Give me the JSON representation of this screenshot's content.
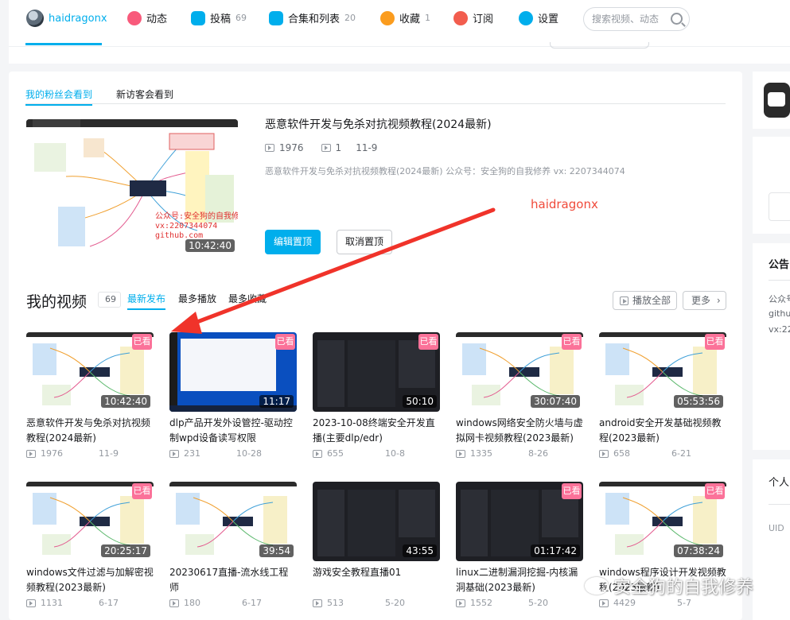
{
  "nav": {
    "username": "haidragonx",
    "items": [
      {
        "label": "动态",
        "count": "",
        "icon": "dynamic-icon",
        "color": "#f85a7b"
      },
      {
        "label": "投稿",
        "count": "69",
        "icon": "upload-icon",
        "color": "#00aeec"
      },
      {
        "label": "合集和列表",
        "count": "20",
        "icon": "collection-icon",
        "color": "#00aeec"
      },
      {
        "label": "收藏",
        "count": "1",
        "icon": "star-icon",
        "color": "#fb9c1e"
      },
      {
        "label": "订阅",
        "count": "",
        "icon": "heart-icon",
        "color": "#f25d4e"
      },
      {
        "label": "设置",
        "count": "",
        "icon": "gear-icon",
        "color": "#00aeec"
      }
    ],
    "search_placeholder": "搜索视频、动态"
  },
  "showcase": {
    "tab_fans": "我的粉丝会看到",
    "tab_visitors": "新访客会看到",
    "video": {
      "title": "恶意软件开发与免杀对抗视频教程(2024最新)",
      "plays": "1976",
      "comments": "1",
      "date": "11-9",
      "description": "恶意软件开发与免杀对抗视频教程(2024最新) 公众号：安全狗的自我修养 vx: 2207344074",
      "duration": "10:42:40",
      "thumb_text1": "公众号:安全狗的自我修养",
      "thumb_text2": "vx:2207344074",
      "thumb_text3": "github.com"
    },
    "edit_label": "编辑置顶",
    "unpin_label": "取消置顶"
  },
  "videos_section": {
    "title": "我的视频",
    "count": "69",
    "sort_tabs": [
      "最新发布",
      "最多播放",
      "最多收藏"
    ],
    "play_all": "播放全部",
    "more": "更多"
  },
  "videos": [
    {
      "title": "恶意软件开发与免杀对抗视频教程(2024最新)",
      "duration": "10:42:40",
      "plays": "1976",
      "date": "11-9",
      "badge": "已看",
      "style": "mind"
    },
    {
      "title": "dlp产品开发外设管控-驱动控制wpd设备读写权限",
      "duration": "11:17",
      "plays": "231",
      "date": "10-28",
      "badge": "已看",
      "style": "win"
    },
    {
      "title": "2023-10-08终端安全开发直播(主要dlp/edr)",
      "duration": "50:10",
      "plays": "655",
      "date": "10-8",
      "badge": "已看",
      "style": "dark"
    },
    {
      "title": "windows网络安全防火墙与虚拟网卡视频教程(2023最新)",
      "duration": "30:07:40",
      "plays": "1335",
      "date": "8-26",
      "badge": "已看",
      "style": "mind"
    },
    {
      "title": "android安全开发基础视频教程(2023最新)",
      "duration": "05:53:56",
      "plays": "658",
      "date": "6-21",
      "badge": "已看",
      "style": "mind"
    },
    {
      "title": "windows文件过滤与加解密视频教程(2023最新)",
      "duration": "20:25:17",
      "plays": "1131",
      "date": "6-17",
      "badge": "已看",
      "style": "mind"
    },
    {
      "title": "20230617直播-流水线工程师",
      "duration": "39:54",
      "plays": "180",
      "date": "6-17",
      "badge": "",
      "style": "mind"
    },
    {
      "title": "游戏安全教程直播01",
      "duration": "43:55",
      "plays": "513",
      "date": "5-20",
      "badge": "",
      "style": "dark"
    },
    {
      "title": "linux二进制漏洞挖掘-内核漏洞基础(2023最新)",
      "duration": "01:17:42",
      "plays": "1552",
      "date": "5-20",
      "badge": "已看",
      "style": "dark"
    },
    {
      "title": "windows程序设计开发视频教程(2023最新)",
      "duration": "07:38:24",
      "plays": "4429",
      "date": "5-7",
      "badge": "已看",
      "style": "mind"
    }
  ],
  "sidebar": {
    "announcement_title": "公告",
    "announcement_lines": [
      "公众号",
      "github",
      "vx:22"
    ],
    "personal_title": "个人",
    "uid_label": "UID"
  },
  "annotation": {
    "name": "haidragonx",
    "arrow_color": "#f0332a",
    "watermark": "安全狗的自我修养"
  }
}
